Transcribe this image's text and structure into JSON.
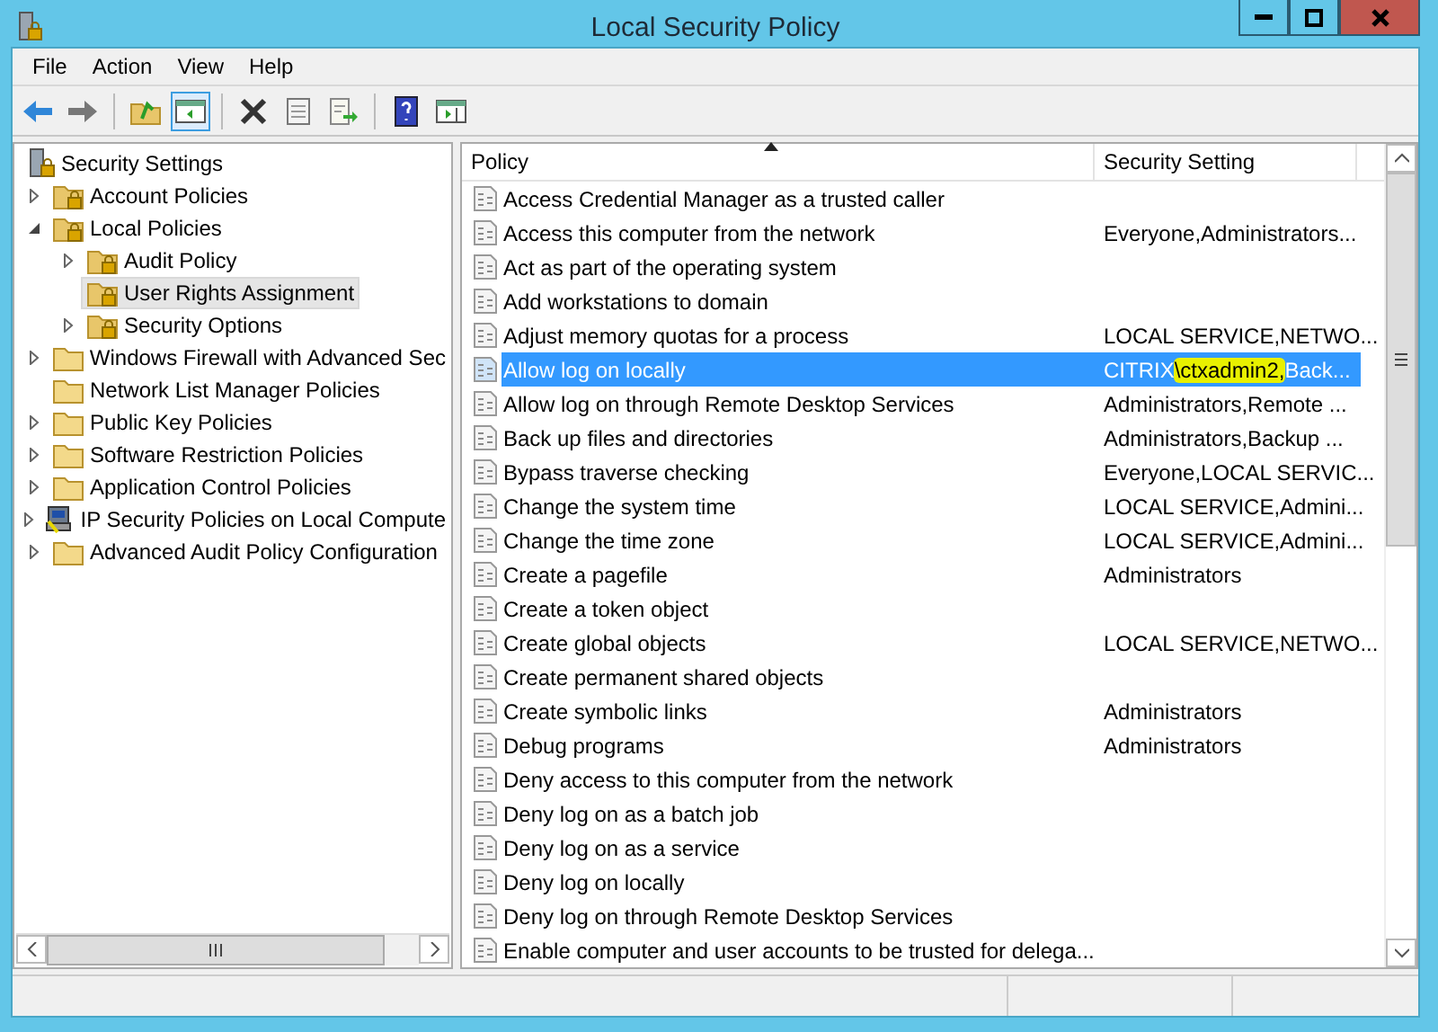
{
  "window": {
    "title": "Local Security Policy"
  },
  "menu": [
    "File",
    "Action",
    "View",
    "Help"
  ],
  "toolbar": [
    {
      "kind": "back",
      "pressed": false
    },
    {
      "kind": "forward",
      "pressed": false
    },
    {
      "kind": "sep"
    },
    {
      "kind": "up",
      "pressed": false
    },
    {
      "kind": "tree",
      "pressed": true
    },
    {
      "kind": "sep"
    },
    {
      "kind": "delete",
      "pressed": false
    },
    {
      "kind": "properties",
      "pressed": false
    },
    {
      "kind": "export",
      "pressed": false
    },
    {
      "kind": "sep"
    },
    {
      "kind": "help",
      "pressed": false
    },
    {
      "kind": "pane",
      "pressed": false
    }
  ],
  "tree": {
    "label": "Security Settings",
    "children": [
      {
        "label": "Account Policies",
        "kind": "folder",
        "expanded": false,
        "selected": false
      },
      {
        "label": "Local Policies",
        "kind": "folder",
        "expanded": true,
        "selected": false,
        "children": [
          {
            "label": "Audit Policy",
            "kind": "folder",
            "expanded": false,
            "selected": false
          },
          {
            "label": "User Rights Assignment",
            "kind": "folder",
            "selected": true
          },
          {
            "label": "Security Options",
            "kind": "folder",
            "expanded": false,
            "selected": false
          }
        ]
      },
      {
        "label": "Windows Firewall with Advanced Sec",
        "kind": "plain",
        "expanded": false,
        "selected": false
      },
      {
        "label": "Network List Manager Policies",
        "kind": "plain",
        "selected": false
      },
      {
        "label": "Public Key Policies",
        "kind": "plain",
        "expanded": false,
        "selected": false
      },
      {
        "label": "Software Restriction Policies",
        "kind": "plain",
        "expanded": false,
        "selected": false
      },
      {
        "label": "Application Control Policies",
        "kind": "plain",
        "expanded": false,
        "selected": false
      },
      {
        "label": "IP Security Policies on Local Compute",
        "kind": "computer",
        "expanded": false,
        "selected": false
      },
      {
        "label": "Advanced Audit Policy Configuration",
        "kind": "plain",
        "expanded": false,
        "selected": false
      }
    ]
  },
  "table": {
    "columns": [
      "Policy",
      "Security Setting"
    ],
    "rows": [
      {
        "policy": "Access Credential Manager as a trusted caller",
        "setting": [],
        "selected": false
      },
      {
        "policy": "Access this computer from the network",
        "setting": [
          {
            "text": "Everyone,Administrators...",
            "highlighted": false
          }
        ],
        "selected": false
      },
      {
        "policy": "Act as part of the operating system",
        "setting": [],
        "selected": false
      },
      {
        "policy": "Add workstations to domain",
        "setting": [],
        "selected": false
      },
      {
        "policy": "Adjust memory quotas for a process",
        "setting": [
          {
            "text": "LOCAL SERVICE,NETWO...",
            "highlighted": false
          }
        ],
        "selected": false
      },
      {
        "policy": "Allow log on locally",
        "setting": [
          {
            "text": "CITRIX",
            "highlighted": false
          },
          {
            "text": "\\ctxadmin2,",
            "highlighted": true
          },
          {
            "text": "Back...",
            "highlighted": false
          }
        ],
        "selected": true
      },
      {
        "policy": "Allow log on through Remote Desktop Services",
        "setting": [
          {
            "text": "Administrators,Remote ...",
            "highlighted": false
          }
        ],
        "selected": false
      },
      {
        "policy": "Back up files and directories",
        "setting": [
          {
            "text": "Administrators,Backup ...",
            "highlighted": false
          }
        ],
        "selected": false
      },
      {
        "policy": "Bypass traverse checking",
        "setting": [
          {
            "text": "Everyone,LOCAL SERVIC...",
            "highlighted": false
          }
        ],
        "selected": false
      },
      {
        "policy": "Change the system time",
        "setting": [
          {
            "text": "LOCAL SERVICE,Admini...",
            "highlighted": false
          }
        ],
        "selected": false
      },
      {
        "policy": "Change the time zone",
        "setting": [
          {
            "text": "LOCAL SERVICE,Admini...",
            "highlighted": false
          }
        ],
        "selected": false
      },
      {
        "policy": "Create a pagefile",
        "setting": [
          {
            "text": "Administrators",
            "highlighted": false
          }
        ],
        "selected": false
      },
      {
        "policy": "Create a token object",
        "setting": [],
        "selected": false
      },
      {
        "policy": "Create global objects",
        "setting": [
          {
            "text": "LOCAL SERVICE,NETWO...",
            "highlighted": false
          }
        ],
        "selected": false
      },
      {
        "policy": "Create permanent shared objects",
        "setting": [],
        "selected": false
      },
      {
        "policy": "Create symbolic links",
        "setting": [
          {
            "text": "Administrators",
            "highlighted": false
          }
        ],
        "selected": false
      },
      {
        "policy": "Debug programs",
        "setting": [
          {
            "text": "Administrators",
            "highlighted": false
          }
        ],
        "selected": false
      },
      {
        "policy": "Deny access to this computer from the network",
        "setting": [],
        "selected": false
      },
      {
        "policy": "Deny log on as a batch job",
        "setting": [],
        "selected": false
      },
      {
        "policy": "Deny log on as a service",
        "setting": [],
        "selected": false
      },
      {
        "policy": "Deny log on locally",
        "setting": [],
        "selected": false
      },
      {
        "policy": "Deny log on through Remote Desktop Services",
        "setting": [],
        "selected": false
      },
      {
        "policy": "Enable computer and user accounts to be trusted for delega...",
        "setting": [],
        "selected": false
      }
    ]
  }
}
